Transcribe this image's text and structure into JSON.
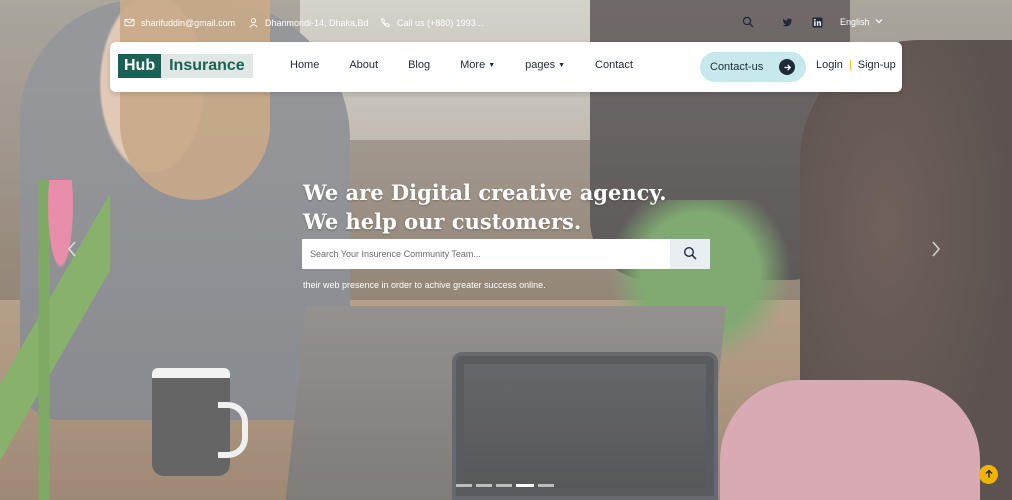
{
  "topbar": {
    "email": "sharifuddin@gmail.com",
    "address": "Dhanmondi-14, Dhaka,Bd",
    "phone": "Call us (+880) 1993...",
    "language": "English"
  },
  "logo": {
    "part1": "Hub",
    "part2": "Insurance"
  },
  "nav": {
    "items": [
      {
        "label": "Home"
      },
      {
        "label": "About"
      },
      {
        "label": "Blog"
      },
      {
        "label": "More"
      },
      {
        "label": "pages"
      },
      {
        "label": "Contact"
      }
    ],
    "contact_button": "Contact-us",
    "login": "Login",
    "signup": "Sign-up",
    "separator": "|"
  },
  "hero": {
    "headline": "We are Digital creative agency. We help our customers.",
    "search_placeholder": "Search Your Insurence Community Team...",
    "subtext": "their web presence in order to achive greater success online."
  },
  "icons": {
    "email": "mail-icon",
    "address": "person-pin-icon",
    "phone": "phone-icon",
    "search": "search-icon",
    "twitter": "twitter-icon",
    "linkedin": "linkedin-icon",
    "language": "chevron-down-icon",
    "contact_arrow": "arrow-right-icon",
    "to_top": "arrow-up-icon"
  },
  "colors": {
    "brand": "#1c6155",
    "accent_yellow": "#f0b400",
    "contact_bg": "#c7e8ec",
    "text_dark": "#1e2a38"
  }
}
